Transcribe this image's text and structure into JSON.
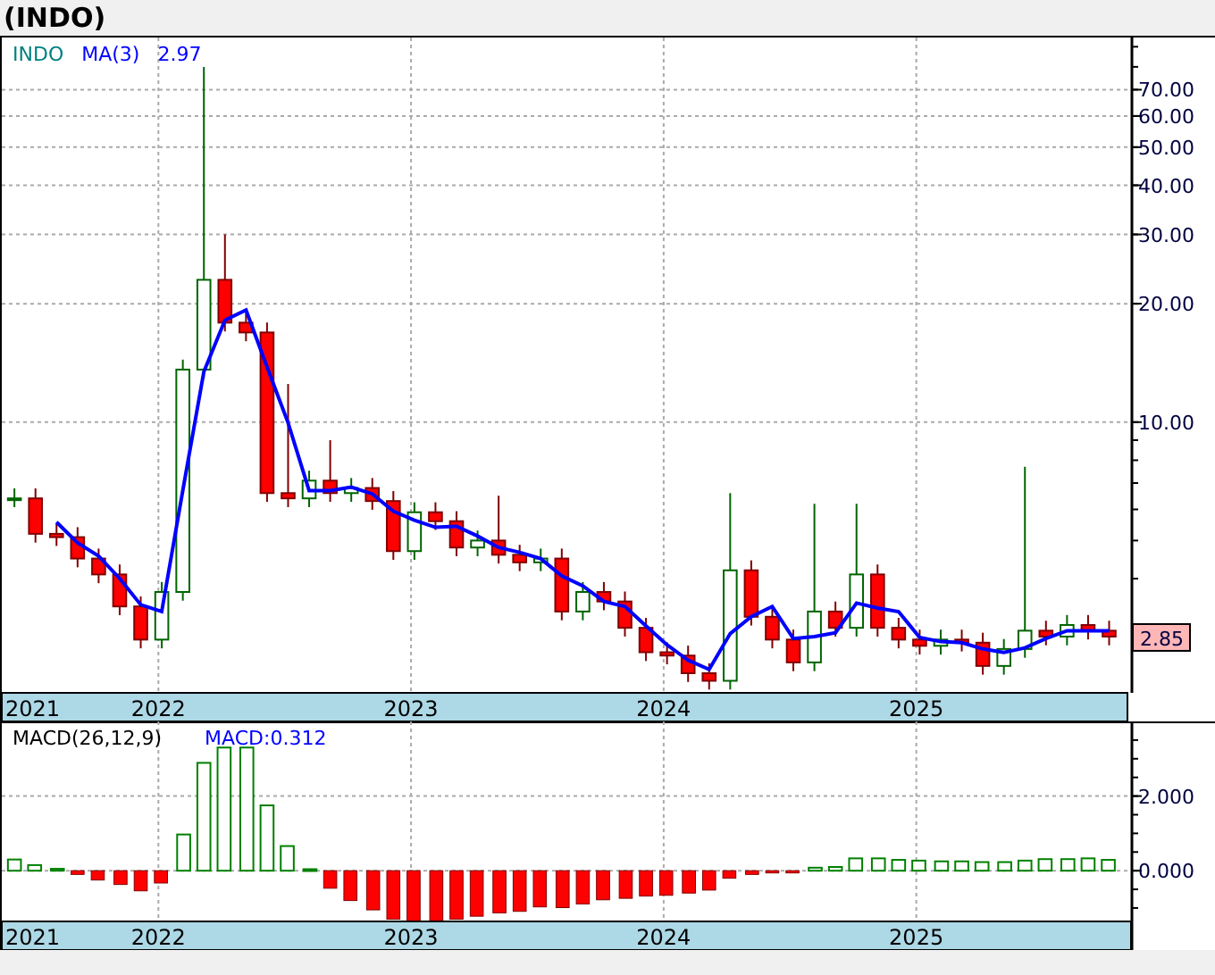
{
  "title": "(INDO)",
  "price_panel": {
    "legend": [
      "INDO",
      "MA(3)",
      "2.97"
    ],
    "last_price": "2.85",
    "axis_labels": [
      "70.00",
      "60.00",
      "50.00",
      "40.00",
      "30.00",
      "20.00",
      "10.00"
    ],
    "year_labels": [
      "2021",
      "2022",
      "2023",
      "2024",
      "2025"
    ]
  },
  "macd_panel": {
    "indicator_value": "MACD:0.312",
    "first_year": "2021",
    "chart_data": {
      "type": "bar",
      "grid": true,
      "x": [
        2021.43,
        2021.51,
        2021.6,
        2021.68,
        2021.76,
        2021.85,
        2021.93,
        2022.01,
        2022.1,
        2022.18,
        2022.26,
        2022.35,
        2022.43,
        2022.51,
        2022.6,
        2022.68,
        2022.76,
        2022.85,
        2022.93,
        2023.01,
        2023.1,
        2023.18,
        2023.26,
        2023.35,
        2023.43,
        2023.51,
        2023.6,
        2023.68,
        2023.76,
        2023.85,
        2023.93,
        2024.01,
        2024.1,
        2024.18,
        2024.26,
        2024.35,
        2024.43,
        2024.51,
        2024.6,
        2024.68,
        2024.76,
        2024.85,
        2024.93,
        2025.01,
        2025.1,
        2025.18,
        2025.26,
        2025.35,
        2025.43,
        2025.51,
        2025.6,
        2025.68,
        2025.76
      ],
      "series": [
        {
          "name": "MACD(26,12,9)",
          "values": [
            0.3,
            0.15,
            0.05,
            -0.1,
            -0.25,
            -0.37,
            -0.54,
            -0.33,
            0.97,
            2.89,
            3.3,
            3.3,
            1.75,
            0.66,
            0.04,
            -0.47,
            -0.8,
            -1.05,
            -1.3,
            -1.35,
            -1.35,
            -1.3,
            -1.22,
            -1.13,
            -1.09,
            -0.97,
            -0.99,
            -0.89,
            -0.78,
            -0.74,
            -0.68,
            -0.66,
            -0.6,
            -0.52,
            -0.2,
            -0.1,
            -0.06,
            -0.06,
            0.08,
            0.1,
            0.33,
            0.33,
            0.29,
            0.27,
            0.25,
            0.25,
            0.23,
            0.23,
            0.27,
            0.31,
            0.31,
            0.33,
            0.29
          ]
        }
      ],
      "xlim": [
        2021.38,
        2025.85
      ],
      "ylim": [
        -1.36,
        4.0
      ],
      "xticks": [
        2022,
        2023,
        2024,
        2025
      ],
      "yticks": [
        {
          "value": 0,
          "label": "0.000"
        },
        {
          "value": 2,
          "label": "2.000"
        }
      ]
    }
  }
}
